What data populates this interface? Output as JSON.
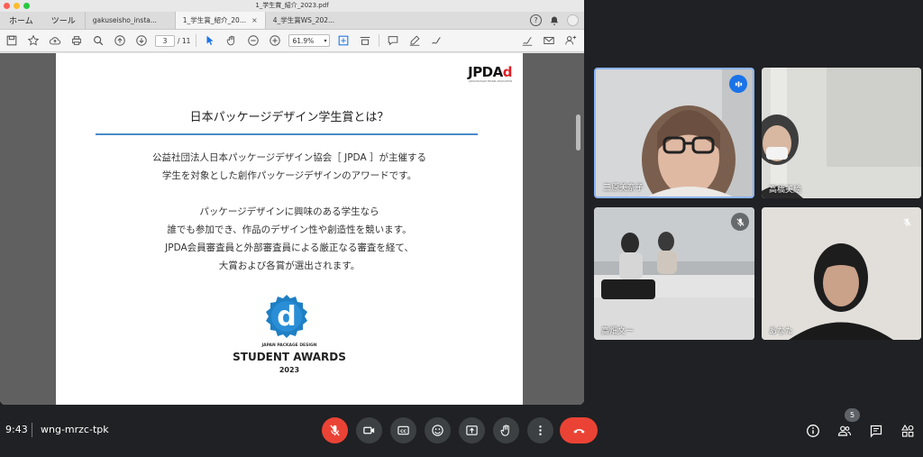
{
  "window": {
    "title": "1_学生賞_紹介_2023.pdf"
  },
  "tabbar": {
    "home": "ホーム",
    "tools": "ツール",
    "tabs": [
      {
        "label": "gakuseisho_insta...",
        "active": false
      },
      {
        "label": "1_学生賞_紹介_20...",
        "active": true
      },
      {
        "label": "4_学生賞WS_202...",
        "active": false
      }
    ]
  },
  "toolbar": {
    "page_current": "3",
    "page_total": "/ 11",
    "zoom": "61.9%"
  },
  "slide": {
    "logo": "JPDA",
    "logo_sub": "JAPAN PACKAGE DESIGN ASSOCIATION",
    "title": "日本パッケージデザイン学生賞とは？",
    "para1": [
      "公益社団法人日本パッケージデザイン協会［ JPDA ］が主催する",
      "学生を対象とした創作パッケージデザインのアワードです。"
    ],
    "para2": [
      "パッケージデザインに興味のある学生なら",
      "誰でも参加でき、作品のデザイン性や創造性を競います。",
      "JPDA会員審査員と外部審査員による厳正なる審査を経て、",
      "大賞および各賞が選出されます。"
    ],
    "award_badge_letter": "d",
    "award_small": "JAPAN PACKAGE DESIGN",
    "award_big": "STUDENT AWARDS",
    "award_year": "2023"
  },
  "participants": [
    {
      "name": "三原美奈子",
      "speaking": true
    },
    {
      "name": "高橋美絵",
      "speaking": false
    },
    {
      "name": "高畑文一",
      "muted": true
    },
    {
      "name": "あなた",
      "muted": true
    }
  ],
  "meeting": {
    "time": "9:43",
    "code": "wng-mrzc-tpk",
    "people_count": "5"
  },
  "colors": {
    "meet_bg": "#202124",
    "danger": "#ea4335",
    "speaking_border": "#8ab4f8",
    "jpda_red": "#e01f26",
    "badge_blue": "#1f7fc4"
  }
}
